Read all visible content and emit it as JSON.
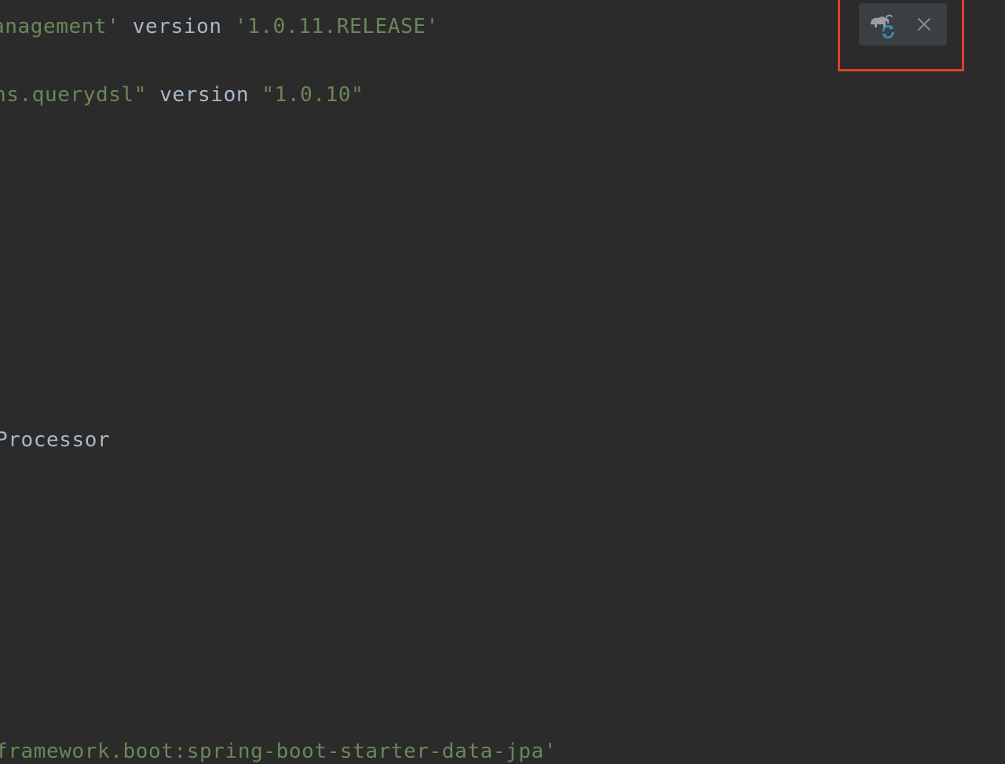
{
  "editor": {
    "lines": [
      {
        "tokens": [
          {
            "text": "anagement'",
            "kind": "str"
          },
          {
            "text": " version ",
            "kind": "ident"
          },
          {
            "text": "'1.0.11.RELEASE'",
            "kind": "str"
          }
        ]
      },
      {
        "tokens": [
          {
            "text": "ns.querydsl\"",
            "kind": "str"
          },
          {
            "text": " version ",
            "kind": "ident"
          },
          {
            "text": "\"1.0.10\"",
            "kind": "str"
          }
        ]
      },
      {
        "tokens": [
          {
            "text": "Processor",
            "kind": "plain"
          }
        ]
      },
      {
        "tokens": [
          {
            "text": "framework.boot:spring-boot-starter-data-jpa'",
            "kind": "str"
          }
        ]
      }
    ]
  },
  "popup": {
    "sync_icon": "gradle-elephant-sync-icon",
    "close_icon": "close-icon"
  },
  "colors": {
    "background": "#2b2b2b",
    "string": "#6a8759",
    "identifier": "#a9b7c6",
    "popup_bg": "#3c3f41",
    "highlight": "#e0402a",
    "sync_blue": "#3592c4"
  }
}
